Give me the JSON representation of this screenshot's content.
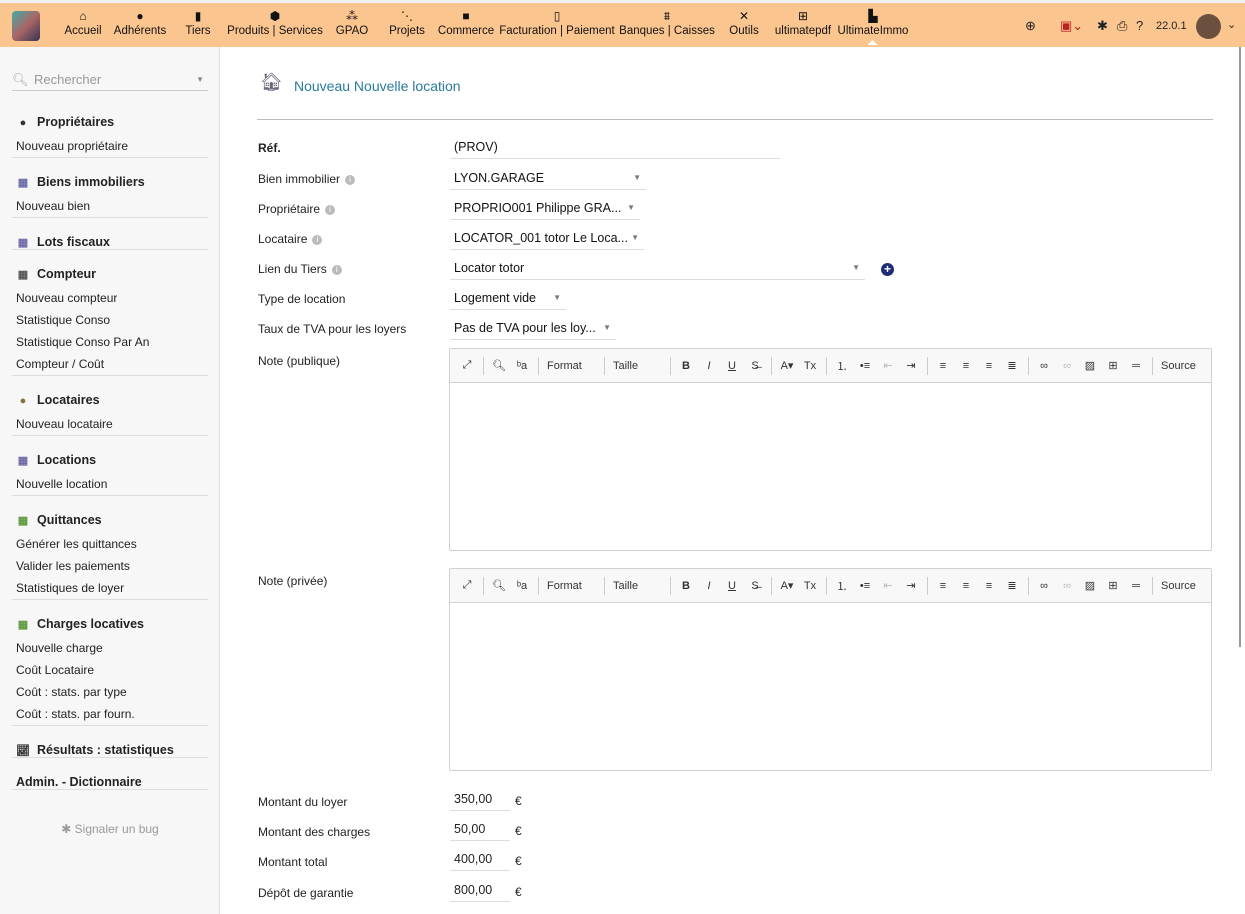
{
  "topbar": {
    "nav": [
      {
        "label": "Accueil",
        "icon": "home-icon",
        "glyph": "⌂"
      },
      {
        "label": "Adhérents",
        "icon": "user-icon",
        "glyph": "●"
      },
      {
        "label": "Tiers",
        "icon": "building-icon",
        "glyph": "▮"
      },
      {
        "label": "Produits | Services",
        "icon": "cube-icon",
        "glyph": "⬢"
      },
      {
        "label": "GPAO",
        "icon": "cubes-icon",
        "glyph": "⁂"
      },
      {
        "label": "Projets",
        "icon": "sitemap-icon",
        "glyph": "⋱"
      },
      {
        "label": "Commerce",
        "icon": "briefcase-icon",
        "glyph": "■"
      },
      {
        "label": "Facturation | Paiement",
        "icon": "invoice-icon",
        "glyph": "▯"
      },
      {
        "label": "Banques | Caisses",
        "icon": "bank-icon",
        "glyph": "⩩"
      },
      {
        "label": "Outils",
        "icon": "tools-icon",
        "glyph": "✕"
      },
      {
        "label": "ultimatepdf",
        "icon": "ultimatepdf-icon",
        "glyph": "⊞"
      },
      {
        "label": "UltimateImmo",
        "icon": "ultimateimmo-icon",
        "glyph": "▙"
      }
    ],
    "version": "22.0.1"
  },
  "sidebar": {
    "search_placeholder": "Rechercher",
    "sections": [
      {
        "title": "Propriétaires",
        "icon": "owner-icon",
        "color": "#333",
        "items": [
          "Nouveau propriétaire"
        ]
      },
      {
        "title": "Biens immobiliers",
        "icon": "building-icon",
        "color": "#6b6aa6",
        "items": [
          "Nouveau bien"
        ]
      },
      {
        "title": "Lots fiscaux",
        "icon": "building-icon",
        "color": "#6b6aa6",
        "items": []
      },
      {
        "title": "Compteur",
        "icon": "meter-icon",
        "color": "#555",
        "items": [
          "Nouveau compteur",
          "Statistique Conso",
          "Statistique Conso Par An",
          "Compteur / Coût"
        ]
      },
      {
        "title": "Locataires",
        "icon": "tenant-icon",
        "color": "#8a6d3b",
        "items": [
          "Nouveau locataire"
        ]
      },
      {
        "title": "Locations",
        "icon": "building-icon",
        "color": "#6b6aa6",
        "items": [
          "Nouvelle location"
        ]
      },
      {
        "title": "Quittances",
        "icon": "receipt-icon",
        "color": "#5c9a3c",
        "items": [
          "Générer les quittances",
          "Valider les paiements",
          "Statistiques de loyer"
        ]
      },
      {
        "title": "Charges locatives",
        "icon": "charges-icon",
        "color": "#5c9a3c",
        "items": [
          "Nouvelle charge",
          "Coût Locataire",
          "Coût : stats. par type",
          "Coût : stats. par fourn."
        ]
      },
      {
        "title": "Résultats : statistiques",
        "icon": "chart-icon",
        "color": "#333",
        "items": []
      },
      {
        "title": "Admin. - Dictionnaire",
        "icon": "",
        "color": "#333",
        "items": []
      }
    ],
    "bug_report": "Signaler un bug"
  },
  "main": {
    "title": "Nouveau Nouvelle location",
    "fields": {
      "ref": {
        "label": "Réf.",
        "value": "(PROV)"
      },
      "property": {
        "label": "Bien immobilier",
        "value": "LYON.GARAGE"
      },
      "owner": {
        "label": "Propriétaire",
        "value": "PROPRIO001 Philippe GRA..."
      },
      "tenant": {
        "label": "Locataire",
        "value": "LOCATOR_001 totor Le Loca..."
      },
      "thirdparty": {
        "label": "Lien du Tiers",
        "value": "Locator totor"
      },
      "rent_type": {
        "label": "Type de location",
        "value": "Logement vide"
      },
      "vat": {
        "label": "Taux de TVA pour les loyers",
        "value": "Pas de TVA pour les loy..."
      },
      "note_public": {
        "label": "Note (publique)"
      },
      "note_private": {
        "label": "Note (privée)"
      },
      "rent": {
        "label": "Montant du loyer",
        "value": "350,00"
      },
      "charges": {
        "label": "Montant des charges",
        "value": "50,00"
      },
      "total": {
        "label": "Montant total",
        "value": "400,00"
      },
      "deposit": {
        "label": "Dépôt de garantie",
        "value": "800,00"
      }
    },
    "currency": "€",
    "editor": {
      "format": "Format",
      "size": "Taille",
      "source": "Source"
    }
  }
}
